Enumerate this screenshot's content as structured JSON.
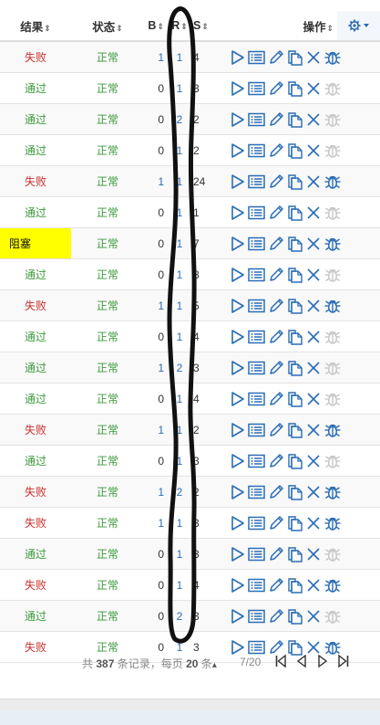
{
  "columns": {
    "result": "结果",
    "status": "状态",
    "b": "B",
    "r": "R",
    "s": "S",
    "ops": "操作",
    "sort_glyph": "⇕"
  },
  "rows": [
    {
      "result": "失败",
      "kind": "fail",
      "status": "正常",
      "b": "1",
      "r": "1",
      "s": "4",
      "bug_active": true
    },
    {
      "result": "通过",
      "kind": "pass",
      "status": "正常",
      "b": "0",
      "r": "1",
      "s": "3",
      "bug_active": false
    },
    {
      "result": "通过",
      "kind": "pass",
      "status": "正常",
      "b": "0",
      "r": "2",
      "s": "2",
      "bug_active": false
    },
    {
      "result": "通过",
      "kind": "pass",
      "status": "正常",
      "b": "0",
      "r": "1",
      "s": "2",
      "bug_active": false
    },
    {
      "result": "失败",
      "kind": "fail",
      "status": "正常",
      "b": "1",
      "r": "1",
      "s": "24",
      "bug_active": true
    },
    {
      "result": "通过",
      "kind": "pass",
      "status": "正常",
      "b": "0",
      "r": "1",
      "s": "1",
      "bug_active": false
    },
    {
      "result": "阻塞",
      "kind": "block",
      "status": "正常",
      "b": "0",
      "r": "1",
      "s": "7",
      "bug_active": true
    },
    {
      "result": "通过",
      "kind": "pass",
      "status": "正常",
      "b": "0",
      "r": "1",
      "s": "8",
      "bug_active": false
    },
    {
      "result": "失败",
      "kind": "fail",
      "status": "正常",
      "b": "1",
      "r": "1",
      "s": "5",
      "bug_active": true
    },
    {
      "result": "通过",
      "kind": "pass",
      "status": "正常",
      "b": "0",
      "r": "1",
      "s": "4",
      "bug_active": false
    },
    {
      "result": "通过",
      "kind": "pass",
      "status": "正常",
      "b": "1",
      "r": "2",
      "s": "3",
      "bug_active": false
    },
    {
      "result": "通过",
      "kind": "pass",
      "status": "正常",
      "b": "0",
      "r": "1",
      "s": "4",
      "bug_active": false
    },
    {
      "result": "失败",
      "kind": "fail",
      "status": "正常",
      "b": "1",
      "r": "1",
      "s": "2",
      "bug_active": true
    },
    {
      "result": "通过",
      "kind": "pass",
      "status": "正常",
      "b": "0",
      "r": "1",
      "s": "3",
      "bug_active": false
    },
    {
      "result": "失败",
      "kind": "fail",
      "status": "正常",
      "b": "1",
      "r": "2",
      "s": "2",
      "bug_active": true
    },
    {
      "result": "失败",
      "kind": "fail",
      "status": "正常",
      "b": "1",
      "r": "1",
      "s": "3",
      "bug_active": true
    },
    {
      "result": "通过",
      "kind": "pass",
      "status": "正常",
      "b": "0",
      "r": "1",
      "s": "3",
      "bug_active": false
    },
    {
      "result": "失败",
      "kind": "fail",
      "status": "正常",
      "b": "0",
      "r": "1",
      "s": "4",
      "bug_active": true
    },
    {
      "result": "通过",
      "kind": "pass",
      "status": "正常",
      "b": "0",
      "r": "2",
      "s": "3",
      "bug_active": false
    },
    {
      "result": "失败",
      "kind": "fail",
      "status": "正常",
      "b": "0",
      "r": "1",
      "s": "3",
      "bug_active": true
    }
  ],
  "pager": {
    "prefix": "共",
    "total": "387",
    "mid": "条记录，每页",
    "per_page": "20",
    "suffix": "条",
    "caret": "▴",
    "page": "7/20"
  },
  "icons": {
    "play": "play-icon",
    "list": "list-icon",
    "edit": "pencil-icon",
    "copy": "copy-icon",
    "delete": "close-icon",
    "bug": "bug-icon",
    "settings": "gear-icon",
    "first": "first-page-icon",
    "prev": "prev-page-icon",
    "next": "next-page-icon",
    "last": "last-page-icon"
  },
  "colors": {
    "fail": "#c9302c",
    "pass": "#3c9a3c",
    "blocked_bg": "#ffff00",
    "icon_blue": "#2a6db5",
    "icon_disabled": "#c8c8c8"
  }
}
